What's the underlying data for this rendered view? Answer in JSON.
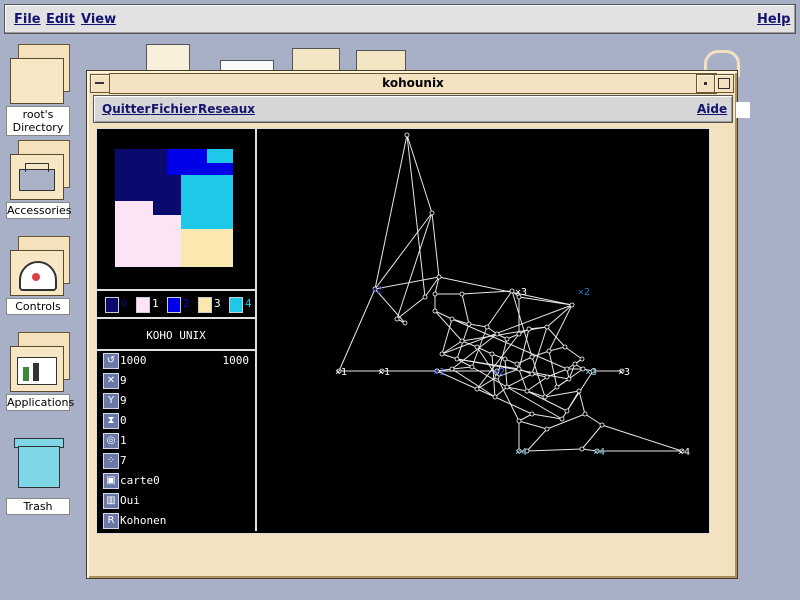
{
  "desktop_menu": {
    "file": "File",
    "edit": "Edit",
    "view": "View",
    "help": "Help"
  },
  "desktop_icons": [
    {
      "label_line1": "root's",
      "label_line2": "Directory"
    },
    {
      "label": "Accessories"
    },
    {
      "label": "Controls"
    },
    {
      "label": "Applications"
    },
    {
      "label": "Trash"
    }
  ],
  "window": {
    "title": "kohounix",
    "menu": {
      "quit": "Quitter",
      "file": "Fichier",
      "networks": "Reseaux",
      "help": "Aide"
    }
  },
  "legend": [
    {
      "label": "0",
      "color": "#0a0a6e"
    },
    {
      "label": "1",
      "color": "#fce4f6"
    },
    {
      "label": "2",
      "color": "#0000e8"
    },
    {
      "label": "3",
      "color": "#fae8b0"
    },
    {
      "label": "4",
      "color": "#1ec8e8"
    }
  ],
  "app_title": "KOHO UNIX",
  "params": [
    {
      "icon": "cycle-icon",
      "value": "1000",
      "value2": "1000"
    },
    {
      "icon": "cross-icon",
      "value": "9"
    },
    {
      "icon": "antenna-icon",
      "value": "9"
    },
    {
      "icon": "hourglass-icon",
      "value": "0"
    },
    {
      "icon": "radius-icon",
      "value": "1"
    },
    {
      "icon": "dots-icon",
      "value": "7"
    },
    {
      "icon": "map-icon",
      "value": "carte0"
    },
    {
      "icon": "bars-icon",
      "value": "Oui"
    },
    {
      "icon": "kohonen-icon",
      "value": "Kohonen"
    }
  ],
  "graph_labels": {
    "class1": "1",
    "class2": "2",
    "class3": "3",
    "class4": "4"
  },
  "colors": {
    "desktop": "#a8b0c8",
    "window": "#f3e2c0",
    "menu_text": "#141470"
  }
}
